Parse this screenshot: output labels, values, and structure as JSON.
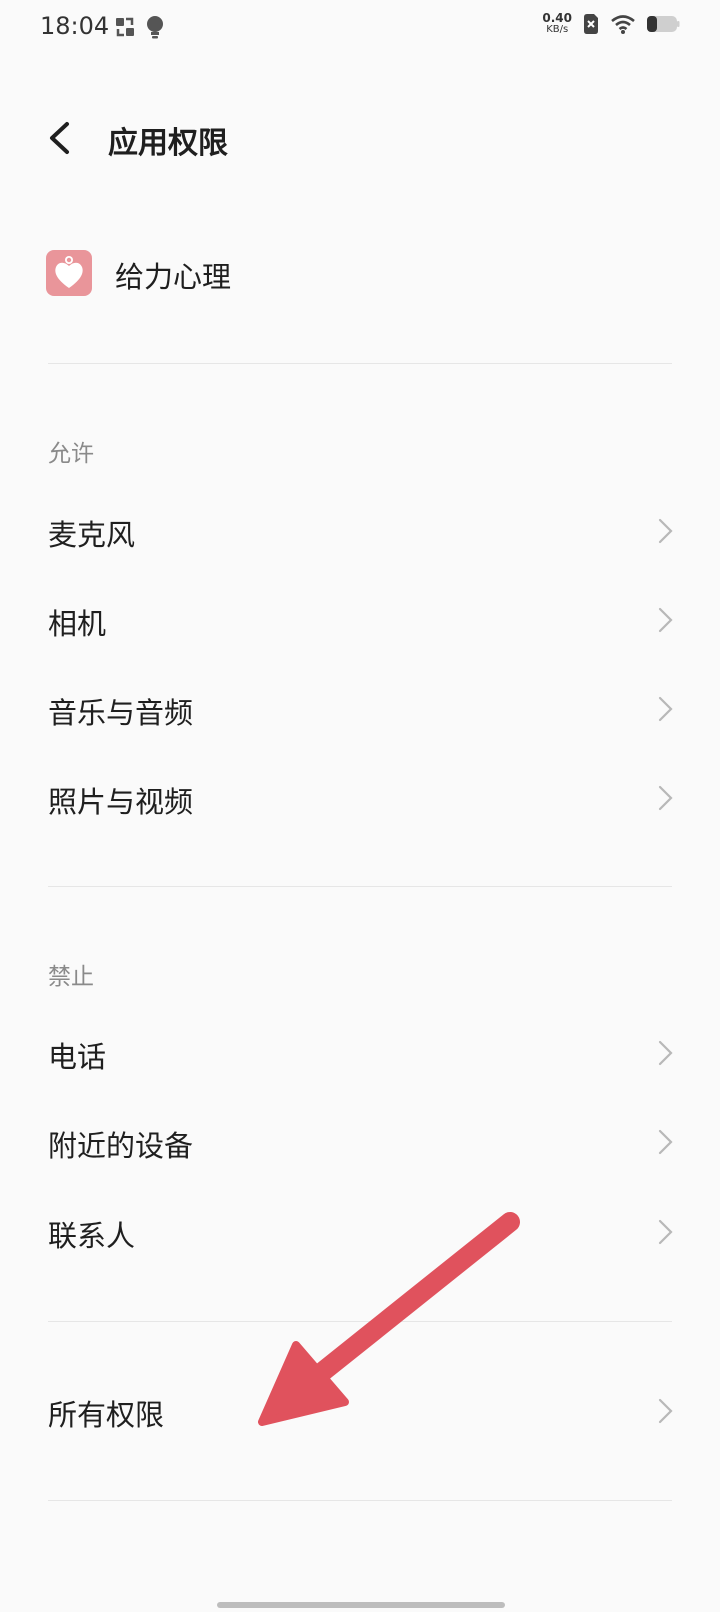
{
  "status_bar": {
    "time": "18:04",
    "net_speed_value": "0.40",
    "net_speed_unit": "KB/s",
    "icons": [
      "screen-record-icon",
      "bulb-icon",
      "sim-disabled-icon",
      "wifi-icon",
      "battery-icon"
    ]
  },
  "header": {
    "title": "应用权限",
    "back_icon": "back-arrow-icon"
  },
  "app": {
    "name": "给力心理",
    "icon": "heart-app-icon",
    "icon_color": "#e9959a"
  },
  "sections": {
    "allowed_label": "允许",
    "allowed_items": [
      {
        "label": "麦克风"
      },
      {
        "label": "相机"
      },
      {
        "label": "音乐与音频"
      },
      {
        "label": "照片与视频"
      }
    ],
    "denied_label": "禁止",
    "denied_items": [
      {
        "label": "电话"
      },
      {
        "label": "附近的设备"
      },
      {
        "label": "联系人"
      }
    ],
    "all_permissions_label": "所有权限"
  },
  "annotation": {
    "arrow_color": "#e0525d"
  }
}
